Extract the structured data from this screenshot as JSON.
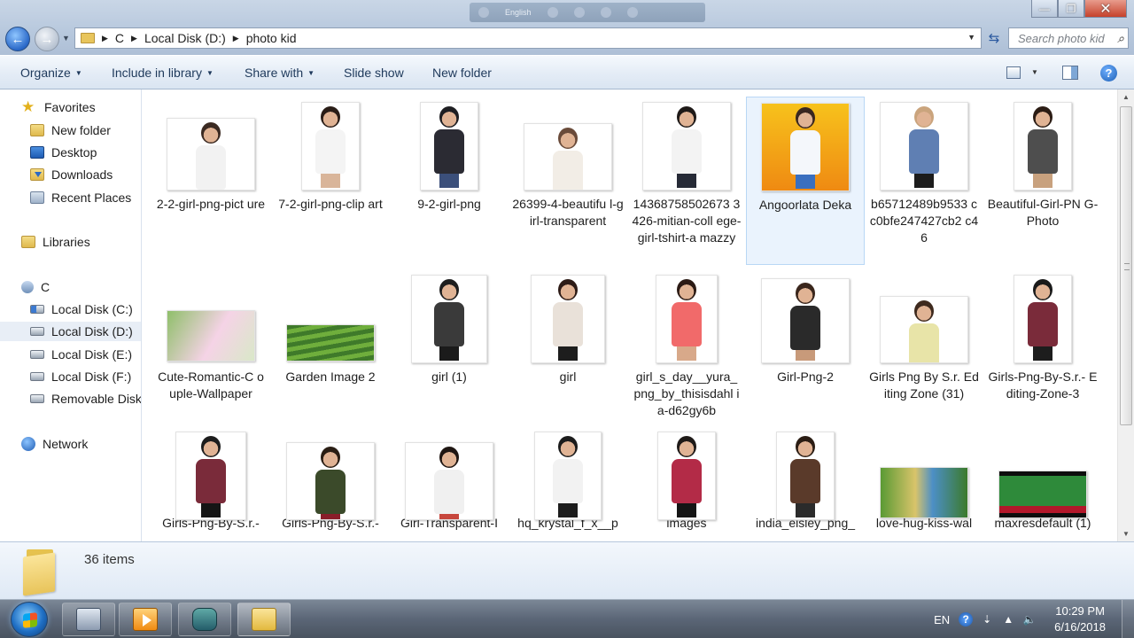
{
  "ime_bar": {
    "language": "English"
  },
  "window": {
    "controls": {
      "minimize": "—",
      "maximize": "❐",
      "close": "✕"
    }
  },
  "address": {
    "crumbs": [
      "C",
      "Local Disk (D:)",
      "photo kid"
    ]
  },
  "search": {
    "placeholder": "Search photo kid"
  },
  "toolbar": {
    "organize": "Organize",
    "include_in_library": "Include in library",
    "share_with": "Share with",
    "slide_show": "Slide show",
    "new_folder": "New folder"
  },
  "nav": {
    "favorites": "Favorites",
    "new_folder": "New folder",
    "desktop": "Desktop",
    "downloads": "Downloads",
    "recent_places": "Recent Places",
    "libraries": "Libraries",
    "user": "C",
    "disk_c": "Local Disk (C:)",
    "disk_d": "Local Disk (D:)",
    "disk_e": "Local Disk (E:)",
    "disk_f": "Local Disk (F:)",
    "removable": "Removable Disk",
    "network": "Network"
  },
  "files": [
    {
      "name": "2-2-girl-png-picture",
      "label": "2-2-girl-png-pict ure"
    },
    {
      "name": "7-2-girl-png-clipart",
      "label": "7-2-girl-png-clip art"
    },
    {
      "name": "9-2-girl-png",
      "label": "9-2-girl-png"
    },
    {
      "name": "26399-4-beautiful-girl-transparent",
      "label": "26399-4-beautifu l-girl-transparent"
    },
    {
      "name": "14368758502673426-mitian-college-girl-tshirt-amazzy",
      "label": "14368758502673 3426-mitian-coll ege-girl-tshirt-a mazzy"
    },
    {
      "name": "Angoorlata Deka",
      "label": "Angoorlata Deka"
    },
    {
      "name": "b65712489b9533cc0bfe247427cb2c46",
      "label": "b65712489b9533 cc0bfe247427cb2 c46"
    },
    {
      "name": "Beautiful-Girl-PNG-Photo",
      "label": "Beautiful-Girl-PN G-Photo"
    },
    {
      "name": "Cute-Romantic-Couple-Wallpaper",
      "label": "Cute-Romantic-C ouple-Wallpaper"
    },
    {
      "name": "Garden Image 2",
      "label": "Garden Image 2"
    },
    {
      "name": "girl (1)",
      "label": "girl (1)"
    },
    {
      "name": "girl",
      "label": "girl"
    },
    {
      "name": "girl_s_day___yura_png_by_thisisdahlia-d62gy6b",
      "label": "girl_s_day__yura_ png_by_thisisdahl ia-d62gy6b"
    },
    {
      "name": "Girl-Png-2",
      "label": "Girl-Png-2"
    },
    {
      "name": "Girls Png By S.r. Editing Zone (31)",
      "label": "Girls Png By S.r. Editing Zone (31)"
    },
    {
      "name": "Girls-Png-By-S.r.-Editing-Zone-3",
      "label": "Girls-Png-By-S.r.- Editing-Zone-3"
    },
    {
      "name": "Girls-Png-By-S.r.-",
      "label": "Girls-Png-By-S.r.-"
    },
    {
      "name": "Girls-Png-By-S.r.-",
      "label": "Girls-Png-By-S.r.-"
    },
    {
      "name": "Girl-Transparent-I",
      "label": "Girl-Transparent-I"
    },
    {
      "name": "hq_krystal_f_x__p",
      "label": "hq_krystal_f_x__p"
    },
    {
      "name": "images",
      "label": "images"
    },
    {
      "name": "india_eisley_png_",
      "label": "india_eisley_png_"
    },
    {
      "name": "love-hug-kiss-wal",
      "label": "love-hug-kiss-wal"
    },
    {
      "name": "maxresdefault (1)",
      "label": "maxresdefault (1)"
    }
  ],
  "details": {
    "item_count": "36 items"
  },
  "taskbar": {
    "language": "EN",
    "time": "10:29 PM",
    "date": "6/16/2018"
  },
  "colors": {
    "accent": "#2a68c8",
    "selection": "#e8eef6"
  }
}
